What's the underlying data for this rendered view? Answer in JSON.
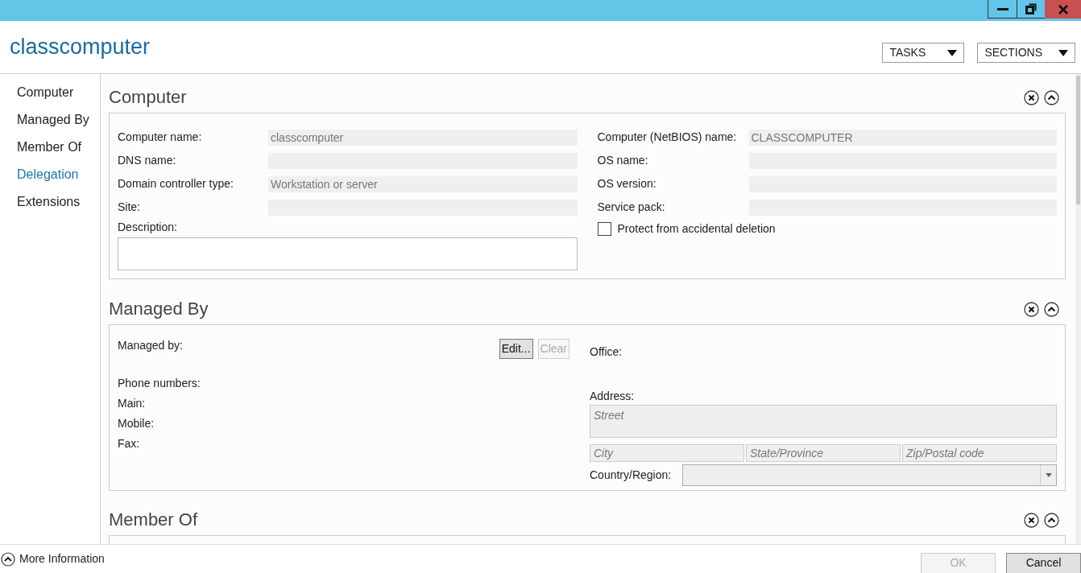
{
  "title": "classcomputer",
  "header_buttons": [
    {
      "label": "TASKS"
    },
    {
      "label": "SECTIONS"
    }
  ],
  "nav": [
    {
      "label": "Computer",
      "selected": false
    },
    {
      "label": "Managed By",
      "selected": false
    },
    {
      "label": "Member Of",
      "selected": false
    },
    {
      "label": "Delegation",
      "selected": true
    },
    {
      "label": "Extensions",
      "selected": false
    }
  ],
  "computer": {
    "heading": "Computer",
    "left_fields": [
      {
        "label": "Computer name:",
        "value": "classcomputer"
      },
      {
        "label": "DNS name:"
      },
      {
        "label": "Domain controller type:",
        "value": "Workstation or server"
      },
      {
        "label": "Site:"
      }
    ],
    "description_label": "Description:",
    "right_fields": [
      {
        "label": "Computer (NetBIOS) name:",
        "value": "CLASSCOMPUTER"
      },
      {
        "label": "OS name:"
      },
      {
        "label": "OS version:"
      },
      {
        "label": "Service pack:"
      }
    ],
    "protect_checkbox": {
      "label": "Protect from accidental deletion",
      "checked": false
    }
  },
  "managed_by": {
    "heading": "Managed By",
    "managed_by_label": "Managed by:",
    "buttons": [
      {
        "label": "Edit...",
        "disabled": false
      },
      {
        "label": "Clear",
        "disabled": true
      }
    ],
    "phone_label": "Phone numbers:",
    "phones": [
      "Main:",
      "Mobile:",
      "Fax:"
    ],
    "office_label": "Office:",
    "address_label": "Address:",
    "street": {
      "placeholder": "Street"
    },
    "city": {
      "placeholder": "City"
    },
    "state": {
      "placeholder": "State/Province"
    },
    "zip": {
      "placeholder": "Zip/Postal code"
    },
    "country_label": "Country/Region:"
  },
  "member_of": {
    "heading": "Member Of"
  },
  "footer": {
    "more_info": "More Information",
    "ok": {
      "label": "OK",
      "disabled": true
    },
    "cancel": {
      "label": "Cancel",
      "disabled": false
    }
  }
}
